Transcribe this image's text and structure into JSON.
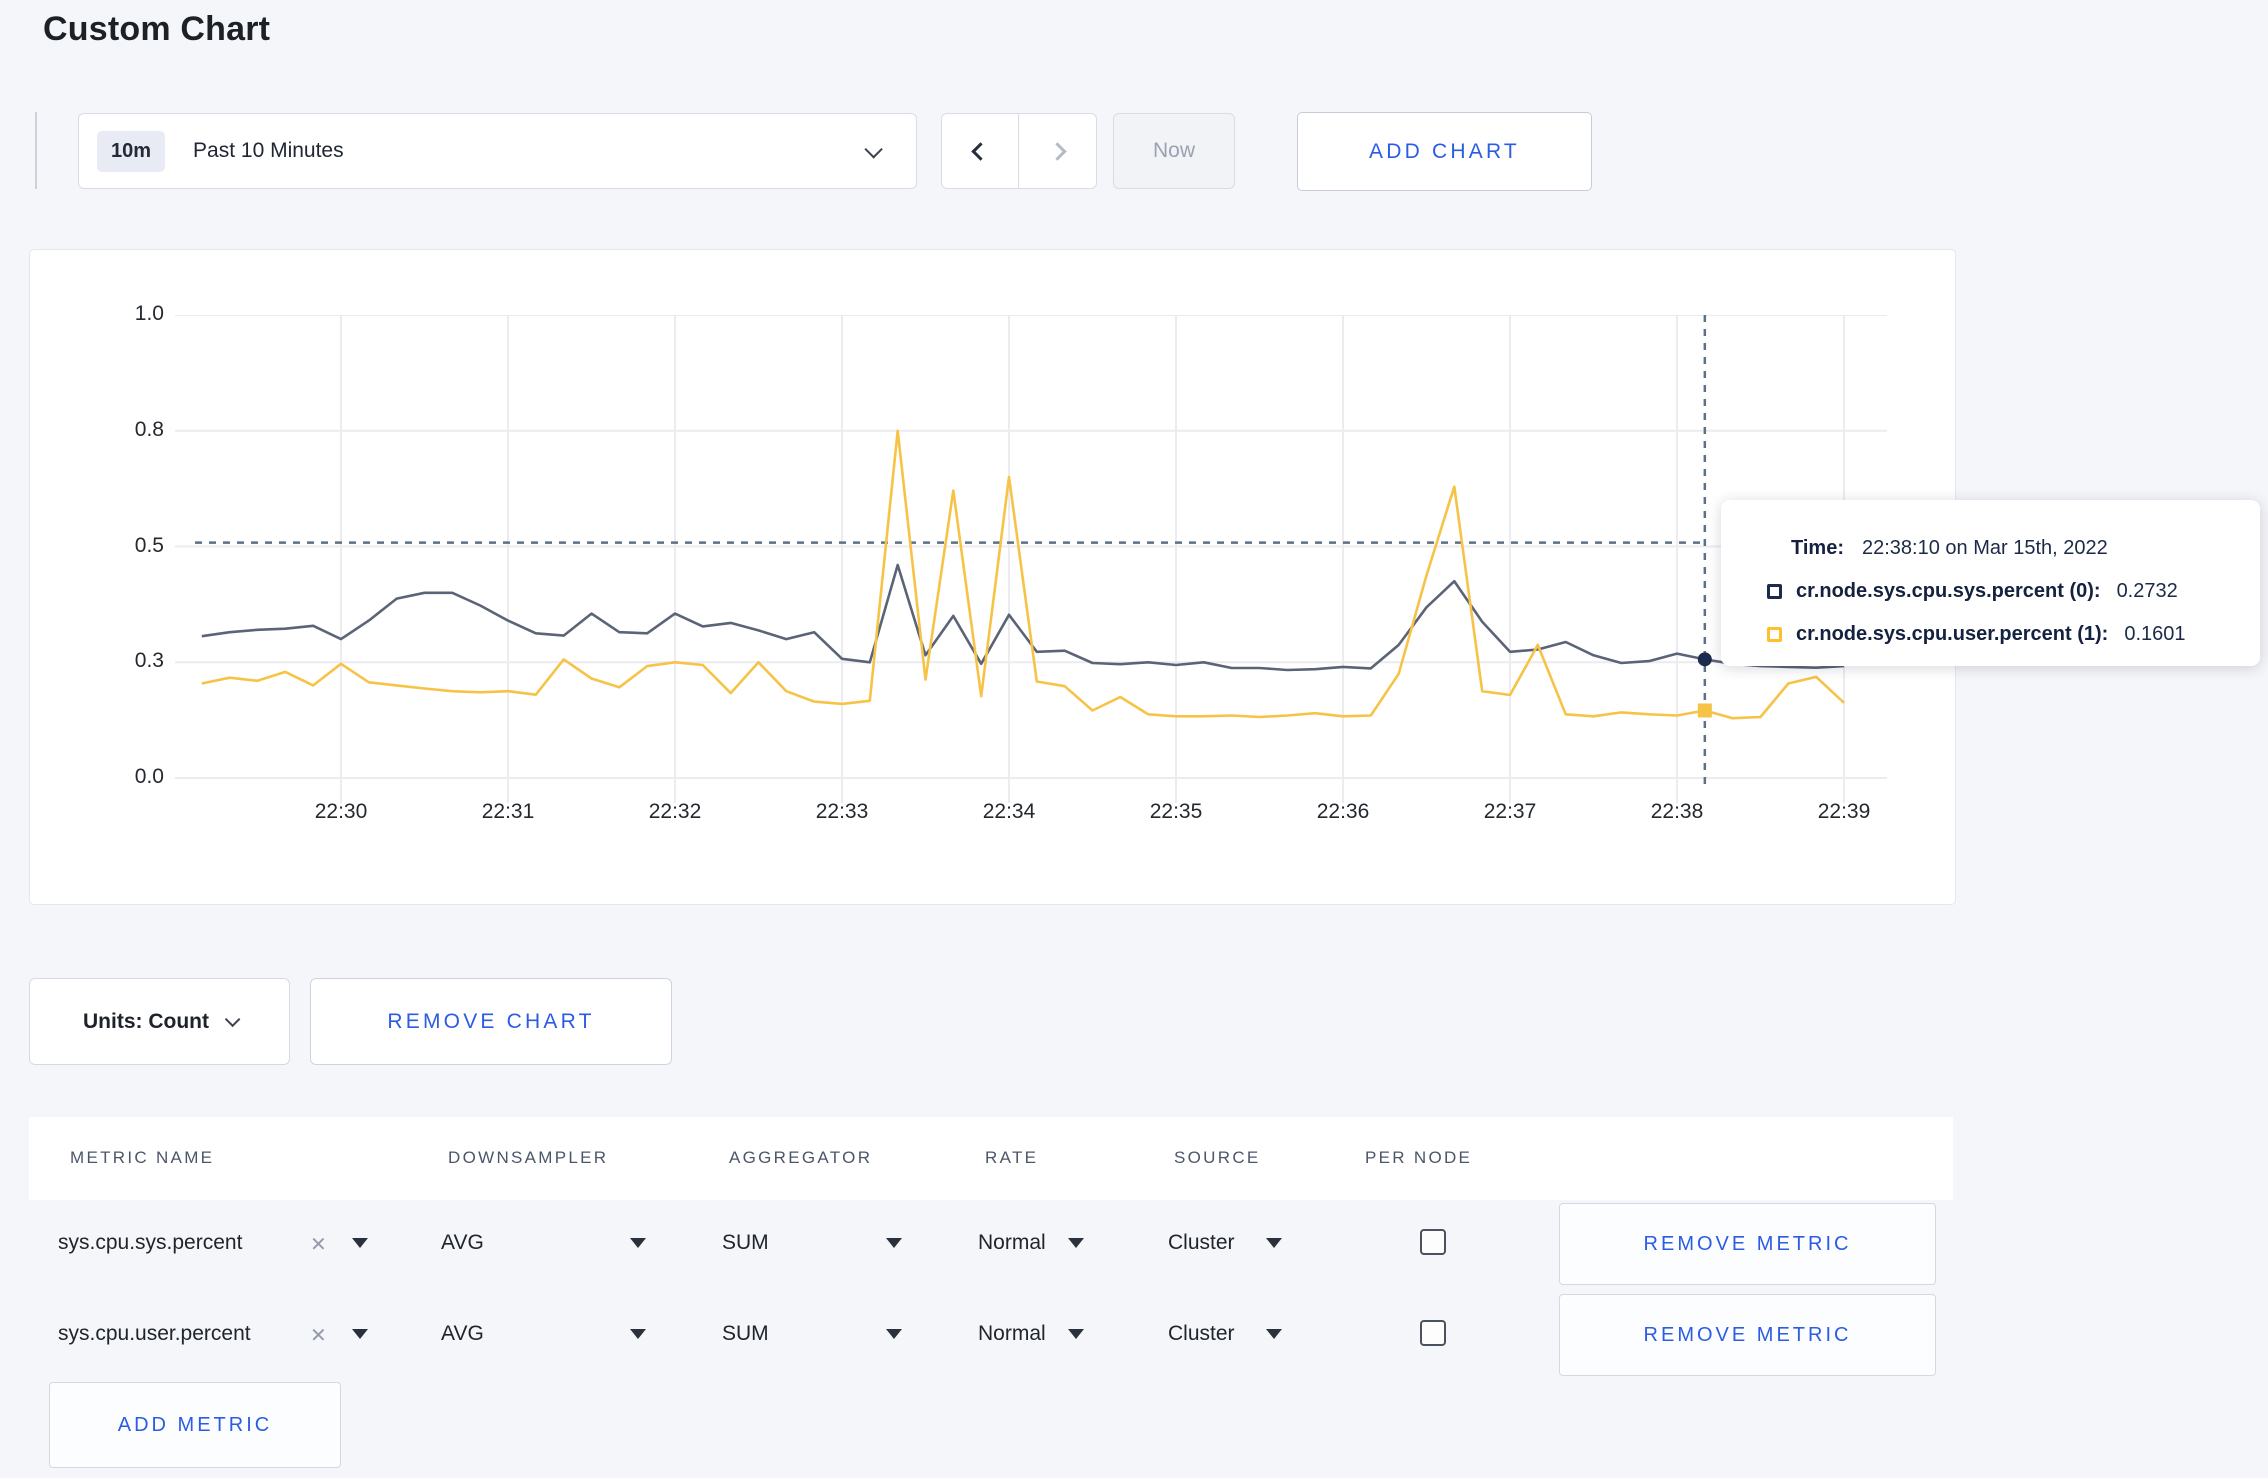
{
  "page": {
    "title": "Custom Chart",
    "background_color": "#f5f6f9",
    "accent_blue": "#2c5be4"
  },
  "toolbar": {
    "time_window_badge": "10m",
    "time_window_label": "Past 10 Minutes",
    "now_label": "Now",
    "add_chart_label": "ADD CHART"
  },
  "chart_data": {
    "type": "line",
    "title": "Custom Chart",
    "grid": true,
    "legend_position": "none",
    "ylim": [
      0,
      1.0
    ],
    "y_axis": {
      "tick_values": [
        0,
        0.3,
        0.5,
        0.8,
        1.0
      ],
      "tick_labels": [
        "0.0",
        "0.3",
        "0.5",
        "0.8",
        "1.0"
      ],
      "note": "ticks rendered equally spaced"
    },
    "x_axis": {
      "tick_labels": [
        "22:30",
        "22:31",
        "22:32",
        "22:33",
        "22:34",
        "22:35",
        "22:36",
        "22:37",
        "22:38",
        "22:39"
      ],
      "start_time": "22:29:10",
      "interval_seconds": 10
    },
    "guideline_value": 0.51,
    "crosshair_time": "22:38:10",
    "highlight_index": 54,
    "grid_color": "#ececf0",
    "guide_color": "#5b7186",
    "series": [
      {
        "name": "cr.node.sys.cpu.sys.percent",
        "color": "#5b6477",
        "swatch_color": "#1c2b4d",
        "marker": "circle",
        "values": [
          0.345,
          0.352,
          0.356,
          0.358,
          0.363,
          0.34,
          0.372,
          0.41,
          0.42,
          0.42,
          0.398,
          0.372,
          0.35,
          0.346,
          0.384,
          0.352,
          0.35,
          0.384,
          0.362,
          0.368,
          0.355,
          0.34,
          0.352,
          0.306,
          0.3,
          0.468,
          0.312,
          0.38,
          0.296,
          0.382,
          0.318,
          0.32,
          0.298,
          0.295,
          0.3,
          0.293,
          0.3,
          0.285,
          0.285,
          0.28,
          0.282,
          0.288,
          0.284,
          0.33,
          0.395,
          0.44,
          0.37,
          0.318,
          0.322,
          0.335,
          0.312,
          0.298,
          0.302,
          0.315,
          0.305,
          0.296,
          0.29,
          0.288,
          0.286,
          0.29
        ]
      },
      {
        "name": "cr.node.sys.cpu.user.percent",
        "color": "#f6c347",
        "swatch_color": "#ffc02e",
        "marker": "square",
        "values": [
          0.245,
          0.26,
          0.252,
          0.275,
          0.24,
          0.296,
          0.248,
          0.24,
          0.232,
          0.225,
          0.222,
          0.225,
          0.216,
          0.305,
          0.258,
          0.235,
          0.29,
          0.3,
          0.293,
          0.22,
          0.3,
          0.225,
          0.198,
          0.192,
          0.2,
          0.8,
          0.255,
          0.645,
          0.212,
          0.68,
          0.25,
          0.238,
          0.175,
          0.21,
          0.165,
          0.16,
          0.16,
          0.162,
          0.158,
          0.162,
          0.168,
          0.16,
          0.162,
          0.27,
          0.45,
          0.655,
          0.225,
          0.215,
          0.33,
          0.165,
          0.16,
          0.17,
          0.165,
          0.162,
          0.175,
          0.155,
          0.158,
          0.245,
          0.262,
          0.195
        ]
      }
    ]
  },
  "tooltip": {
    "time_label": "Time:",
    "time_value": "22:38:10 on Mar 15th, 2022",
    "rows": [
      {
        "label": "cr.node.sys.cpu.sys.percent (0):",
        "value": "0.2732",
        "color": "#1c2b4d"
      },
      {
        "label": "cr.node.sys.cpu.user.percent (1):",
        "value": "0.1601",
        "color": "#ffc02e"
      }
    ]
  },
  "chart_controls": {
    "units_label": "Units: Count",
    "remove_chart_label": "REMOVE CHART"
  },
  "metrics_table": {
    "columns": [
      "METRIC NAME",
      "DOWNSAMPLER",
      "AGGREGATOR",
      "RATE",
      "SOURCE",
      "PER NODE"
    ],
    "clear_glyph": "✕",
    "rows": [
      {
        "metric": "sys.cpu.sys.percent",
        "downsampler": "AVG",
        "aggregator": "SUM",
        "rate": "Normal",
        "source": "Cluster",
        "per_node_checked": false,
        "remove_label": "REMOVE METRIC"
      },
      {
        "metric": "sys.cpu.user.percent",
        "downsampler": "AVG",
        "aggregator": "SUM",
        "rate": "Normal",
        "source": "Cluster",
        "per_node_checked": false,
        "remove_label": "REMOVE METRIC"
      }
    ],
    "add_metric_label": "ADD METRIC"
  }
}
